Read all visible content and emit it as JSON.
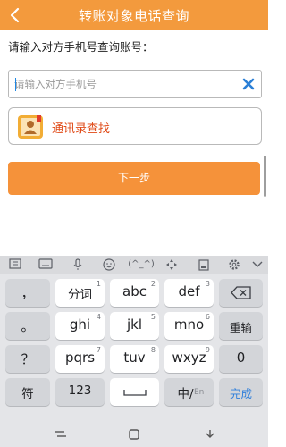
{
  "header": {
    "title": "转账对象电话查询",
    "back_icon": "chevron-left-icon"
  },
  "prompt": "请输入对方手机号查询账号：",
  "phone_input": {
    "placeholder": "请输入对方手机号",
    "value": "",
    "clear_icon": "close-icon"
  },
  "contacts_button": {
    "label": "通讯录查找",
    "icon": "contact-book-icon"
  },
  "next_button": {
    "label": "下一步"
  },
  "colors": {
    "accent": "#f39a3d",
    "contacts_text": "#e04a17",
    "done_text": "#2f7fdb"
  },
  "keyboard": {
    "toolbar": [
      "keyboard-grid-icon",
      "keyboard-icon",
      "microphone-icon",
      "emoji-icon",
      "kaomoji-icon",
      "cursor-move-icon",
      "clipboard-icon",
      "settings-icon",
      "collapse-keyboard-icon"
    ],
    "toolbar_kaomoji": "(^_^)",
    "rows": [
      [
        {
          "main": "，"
        },
        {
          "main": "分词",
          "sub": "1"
        },
        {
          "main": "abc",
          "sub": "2"
        },
        {
          "main": "def",
          "sub": "3"
        },
        {
          "main": "",
          "icon": "backspace-icon"
        }
      ],
      [
        {
          "main": "。"
        },
        {
          "main": "ghi",
          "sub": "4"
        },
        {
          "main": "jkl",
          "sub": "5"
        },
        {
          "main": "mno",
          "sub": "6"
        },
        {
          "main": "重输"
        }
      ],
      [
        {
          "main": "？"
        },
        {
          "main": "pqrs",
          "sub": "7"
        },
        {
          "main": "tuv",
          "sub": "8"
        },
        {
          "main": "wxyz",
          "sub": "9"
        },
        {
          "main": "0"
        }
      ],
      [
        {
          "main": "！"
        }
      ],
      [
        {
          "main": "符"
        },
        {
          "main": "123"
        },
        {
          "main": "",
          "icon": "space-icon"
        },
        {
          "main": "中/",
          "sub2": "En"
        },
        {
          "main": "完成"
        }
      ]
    ]
  },
  "navbar": {
    "icons": [
      "recent-apps-icon",
      "home-icon",
      "back-icon"
    ]
  }
}
